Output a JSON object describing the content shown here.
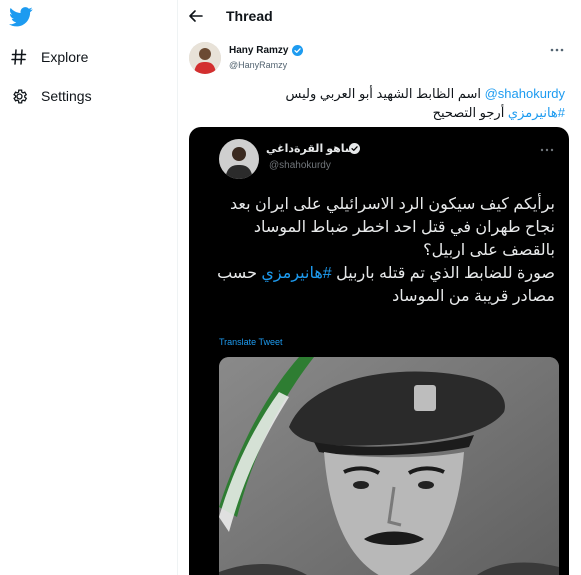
{
  "sidebar": {
    "logo_icon": "twitter-bird-icon",
    "items": [
      {
        "label": "Explore",
        "icon": "hashtag-icon"
      },
      {
        "label": "Settings",
        "icon": "gear-icon"
      }
    ]
  },
  "header": {
    "back_icon": "back-arrow-icon",
    "title": "Thread"
  },
  "tweet": {
    "author_name": "Hany Ramzy",
    "author_handle": "@HanyRamzy",
    "text_mention": "@shahokurdy",
    "text_line1": " اسم الظابط الشهيد أبو العربي وليس",
    "text_hashtag": "#هانيرمزي",
    "text_line2": " أرجو التصحيح"
  },
  "embed": {
    "author_name": "شاهو القرةداغي",
    "author_handle": "@shahokurdy",
    "text_part1": "برأيكم كيف سيكون الرد الاسرائيلي على ايران بعد نجاح طهران في قتل احد اخطر ضباط الموساد بالقصف على اربيل؟",
    "text_part2": "صورة للضابط الذي تم قتله باربيل ",
    "text_hashtag": "#هانيرمزي",
    "text_part3": " حسب مصادر قريبة من الموساد",
    "translate_label": "Translate Tweet"
  },
  "colors": {
    "accent": "#1d9bf0",
    "text": "#0f1419",
    "secondary": "#536471"
  }
}
